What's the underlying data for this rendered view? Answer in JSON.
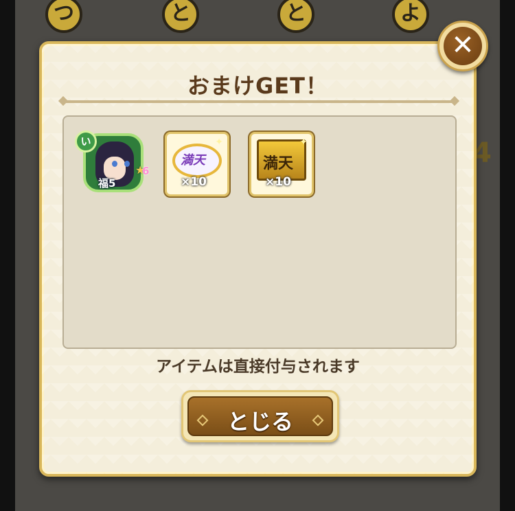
{
  "dialog": {
    "title": "おまけGET！",
    "notice": "アイテムは直接付与されます",
    "close_button_label": "とじる",
    "close_icon": "close-icon"
  },
  "items": [
    {
      "kind": "character",
      "badge": "い",
      "caption": "福5",
      "rarity_number": "6",
      "icon": "character-portrait-icon"
    },
    {
      "kind": "ticket",
      "mark": "満天",
      "count": "×10",
      "icon": "oval-ticket-icon"
    },
    {
      "kind": "ticket",
      "mark": "満天",
      "count": "×10",
      "icon": "gold-ticket-icon"
    }
  ],
  "background": {
    "row_kana": [
      "つ",
      "と",
      "と",
      "よ"
    ],
    "side_number": "4"
  },
  "colors": {
    "dialog_bg": "#f4eedb",
    "dialog_border": "#d9b75b",
    "button_brown": "#8a5a1e",
    "title_text": "#5a3a1c"
  }
}
